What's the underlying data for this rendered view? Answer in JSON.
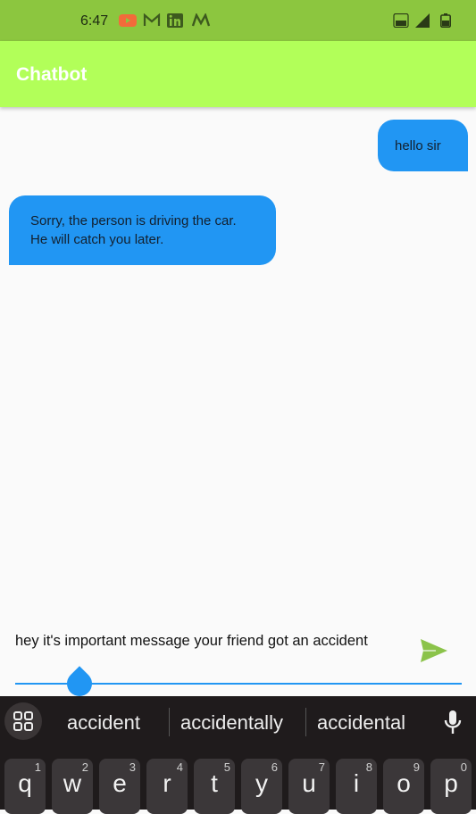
{
  "status_bar": {
    "time": "6:47"
  },
  "app_bar": {
    "title": "Chatbot"
  },
  "messages": [
    {
      "sender": "user",
      "text": "hello sir"
    },
    {
      "sender": "bot",
      "text": "Sorry, the person is driving the car.\nHe will catch you later."
    }
  ],
  "composer": {
    "text": "hey it's important message your friend got an accident"
  },
  "keyboard": {
    "suggestions": [
      "accident",
      "accidentally",
      "accidental"
    ],
    "keys": [
      {
        "letter": "q",
        "num": "1"
      },
      {
        "letter": "w",
        "num": "2"
      },
      {
        "letter": "e",
        "num": "3"
      },
      {
        "letter": "r",
        "num": "4"
      },
      {
        "letter": "t",
        "num": "5"
      },
      {
        "letter": "y",
        "num": "6"
      },
      {
        "letter": "u",
        "num": "7"
      },
      {
        "letter": "i",
        "num": "8"
      },
      {
        "letter": "o",
        "num": "9"
      },
      {
        "letter": "p",
        "num": "0"
      }
    ]
  },
  "colors": {
    "status_bar": "#8cc63f",
    "app_bar": "#b2ff59",
    "bubble": "#2196f3",
    "send": "#8bc34a",
    "keyboard": "#1f1b1c"
  }
}
